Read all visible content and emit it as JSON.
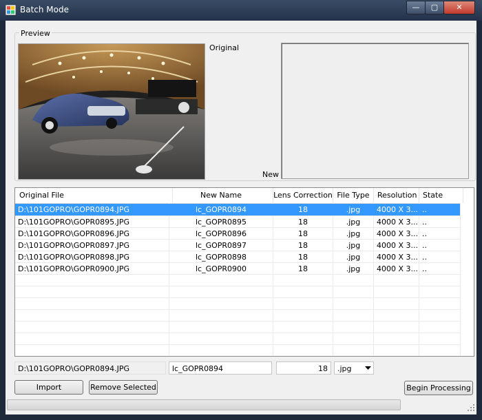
{
  "window": {
    "title": "Batch Mode",
    "controls": {
      "minimize": "—",
      "maximize": "▢",
      "close": "✕"
    }
  },
  "preview": {
    "group_label": "Preview",
    "original_label": "Original",
    "new_label": "New"
  },
  "grid": {
    "columns": [
      "Original File",
      "New Name",
      "Lens Correction",
      "File Type",
      "Resolution",
      "State"
    ],
    "rows": [
      [
        "D:\\101GOPRO\\GOPR0894.JPG",
        "lc_GOPR0894",
        "18",
        ".jpg",
        "4000 X 3...",
        ".."
      ],
      [
        "D:\\101GOPRO\\GOPR0895.JPG",
        "lc_GOPR0895",
        "18",
        ".jpg",
        "4000 X 3...",
        ".."
      ],
      [
        "D:\\101GOPRO\\GOPR0896.JPG",
        "lc_GOPR0896",
        "18",
        ".jpg",
        "4000 X 3...",
        ".."
      ],
      [
        "D:\\101GOPRO\\GOPR0897.JPG",
        "lc_GOPR0897",
        "18",
        ".jpg",
        "4000 X 3...",
        ".."
      ],
      [
        "D:\\101GOPRO\\GOPR0898.JPG",
        "lc_GOPR0898",
        "18",
        ".jpg",
        "4000 X 3...",
        ".."
      ],
      [
        "D:\\101GOPRO\\GOPR0900.JPG",
        "lc_GOPR0900",
        "18",
        ".jpg",
        "4000 X 3...",
        ".."
      ]
    ],
    "selected_row": 0
  },
  "editor": {
    "original_file": "D:\\101GOPRO\\GOPR0894.JPG",
    "new_name": "lc_GOPR0894",
    "lens_correction": "18",
    "file_type": ".jpg"
  },
  "buttons": {
    "import": "Import",
    "remove_selected": "Remove Selected",
    "begin_processing": "Begin Processing"
  },
  "progress": {
    "value": 0
  },
  "colors": {
    "selection": "#3399ff",
    "titlebar": "#2d3e57",
    "background": "#f0f0f0"
  }
}
